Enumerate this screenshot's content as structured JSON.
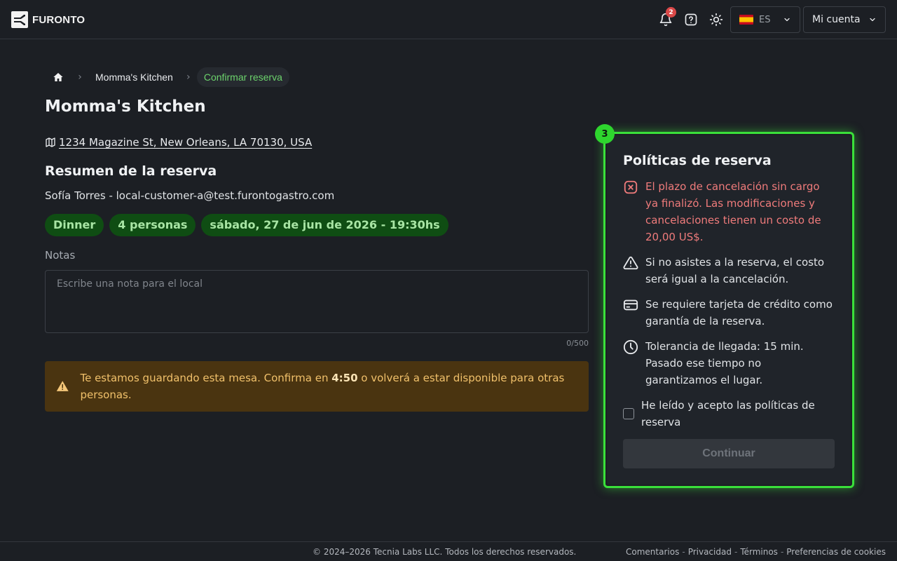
{
  "header": {
    "logo_text": "FURONTO",
    "notification_count": "2",
    "language": {
      "code": "ES",
      "flag": "spain-flag-icon"
    },
    "account_label": "Mi cuenta"
  },
  "breadcrumb": {
    "items": [
      "Momma's Kitchen"
    ],
    "current": "Confirmar reserva"
  },
  "venue": {
    "name": "Momma's Kitchen",
    "address": "1234 Magazine St, New Orleans, LA 70130, USA"
  },
  "summary": {
    "title": "Resumen de la reserva",
    "customer": "Sofía Torres - local-customer-a@test.furontogastro.com",
    "chips": [
      "Dinner",
      "4 personas",
      "sábado, 27 de jun de 2026 - 19:30hs"
    ]
  },
  "notes": {
    "label": "Notas",
    "placeholder": "Escribe una nota para el local",
    "value": "",
    "counter": "0/500"
  },
  "alert": {
    "text_before": "Te estamos guardando esta mesa. Confirma en ",
    "timer": "4:50",
    "text_after": " o volverá a estar disponible para otras personas."
  },
  "policies": {
    "step": "3",
    "title": "Políticas de reserva",
    "items": [
      {
        "icon": "x-square-icon",
        "text": "El plazo de cancelación sin cargo ya finalizó. Las modificaciones y cancelaciones tienen un costo de 20,00 US$."
      },
      {
        "icon": "warning-triangle-icon",
        "text": "Si no asistes a la reserva, el costo será igual a la cancelación."
      },
      {
        "icon": "credit-card-icon",
        "text": "Se requiere tarjeta de crédito como garantía de la reserva."
      },
      {
        "icon": "clock-icon",
        "text": "Tolerancia de llegada: 15 min. Pasado ese tiempo no garantizamos el lugar."
      }
    ],
    "accept_label": "He leído y acepto las políticas de reserva",
    "accepted": false,
    "continue_label": "Continuar"
  },
  "footer": {
    "copyright": "© 2024–2026 Tecnia Labs LLC. Todos los derechos reservados.",
    "links": [
      "Comentarios",
      "Privacidad",
      "Términos",
      "Preferencias de cookies"
    ]
  },
  "colors": {
    "background": "#1c1f24",
    "accent_green": "#3ae03a",
    "chip_bg": "#0f4d13",
    "danger": "#ef7b7b",
    "alert_bg": "#4a3410"
  }
}
